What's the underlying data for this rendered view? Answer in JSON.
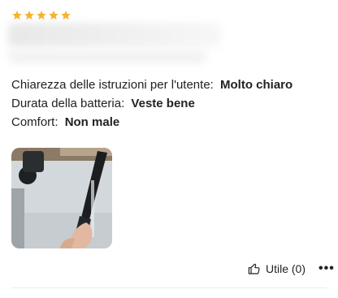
{
  "review": {
    "rating": 5,
    "rating_max": 5,
    "star_color": "#f5b324",
    "attributes": [
      {
        "label": "Chiarezza delle istruzioni per l'utente:",
        "value": "Molto chiaro"
      },
      {
        "label": "Durata della batteria:",
        "value": "Veste bene"
      },
      {
        "label": "Comfort:",
        "value": "Non male"
      }
    ]
  },
  "actions": {
    "helpful_label": "Utile (0)",
    "more_label": "•••"
  },
  "icons": {
    "star": "star-icon",
    "thumbs_up": "thumbs-up-icon",
    "more": "more-icon"
  }
}
